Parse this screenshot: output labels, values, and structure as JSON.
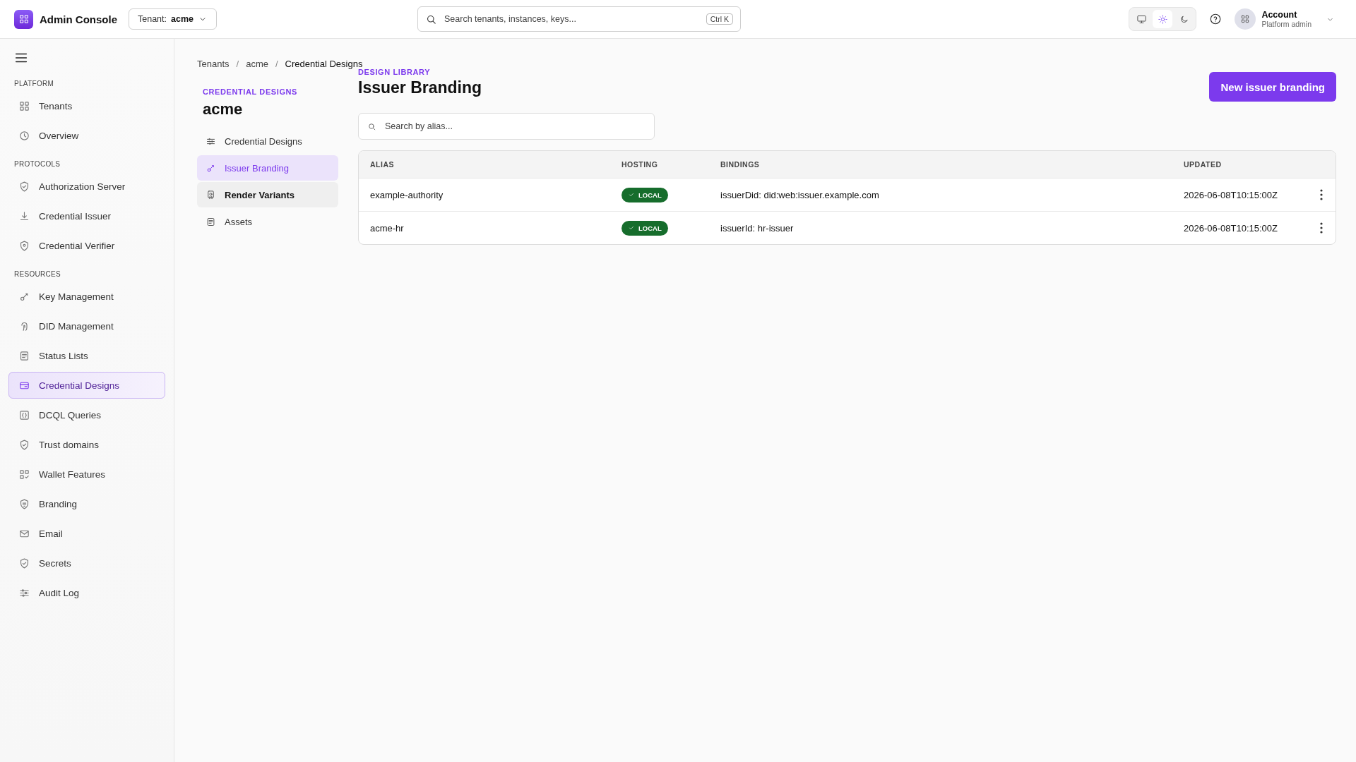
{
  "topbar": {
    "app_title": "Admin Console",
    "tenant_label": "Tenant:",
    "tenant_value": "acme",
    "search_placeholder": "Search tenants, instances, keys...",
    "search_shortcut": "Ctrl K",
    "theme_modes": [
      {
        "selected": false
      },
      {
        "selected": true
      },
      {
        "selected": false
      }
    ],
    "account": {
      "name": "Account",
      "role": "Platform admin"
    }
  },
  "sidebar": {
    "groups": [
      {
        "label": "PLATFORM",
        "items": [
          {
            "label": "Tenants",
            "selected": false
          },
          {
            "label": "Overview",
            "selected": false
          }
        ]
      },
      {
        "label": "PROTOCOLS",
        "items": [
          {
            "label": "Authorization Server",
            "selected": false
          },
          {
            "label": "Credential Issuer",
            "selected": false
          },
          {
            "label": "Credential Verifier",
            "selected": false
          }
        ]
      },
      {
        "label": "RESOURCES",
        "items": [
          {
            "label": "Key Management",
            "selected": false
          },
          {
            "label": "DID Management",
            "selected": false
          },
          {
            "label": "Status Lists",
            "selected": false
          },
          {
            "label": "Credential Designs",
            "selected": true
          },
          {
            "label": "DCQL Queries",
            "selected": false
          },
          {
            "label": "Trust domains",
            "selected": false
          },
          {
            "label": "Wallet Features",
            "selected": false
          },
          {
            "label": "Branding",
            "selected": false
          },
          {
            "label": "Email",
            "selected": false
          },
          {
            "label": "Secrets",
            "selected": false
          },
          {
            "label": "Audit Log",
            "selected": false
          }
        ]
      }
    ]
  },
  "breadcrumb": [
    {
      "kind": "link",
      "text": "Tenants"
    },
    {
      "kind": "separator",
      "text": "/"
    },
    {
      "kind": "link",
      "text": "acme"
    },
    {
      "kind": "separator",
      "text": "/"
    },
    {
      "kind": "current",
      "text": "Credential Designs"
    }
  ],
  "subnav": {
    "eyebrow": "CREDENTIAL DESIGNS",
    "title": "acme",
    "items": [
      {
        "label": "Credential Designs",
        "selected": false,
        "hovered": false
      },
      {
        "label": "Issuer Branding",
        "selected": true,
        "hovered": false
      },
      {
        "label": "Render Variants",
        "selected": false,
        "hovered": true
      },
      {
        "label": "Assets",
        "selected": false,
        "hovered": false
      }
    ]
  },
  "main": {
    "eyebrow": "DESIGN LIBRARY",
    "title": "Issuer Branding",
    "new_button": "New issuer branding",
    "search_placeholder": "Search by alias...",
    "table": {
      "columns": [
        "ALIAS",
        "HOSTING",
        "BINDINGS",
        "UPDATED"
      ],
      "rows": [
        {
          "alias": "example-authority",
          "hosting": "LOCAL",
          "bindings": "issuerDid: did:web:issuer.example.com",
          "updated": "2026-06-08T10:15:00Z"
        },
        {
          "alias": "acme-hr",
          "hosting": "LOCAL",
          "bindings": "issuerId: hr-issuer",
          "updated": "2026-06-08T10:15:00Z"
        }
      ]
    }
  }
}
